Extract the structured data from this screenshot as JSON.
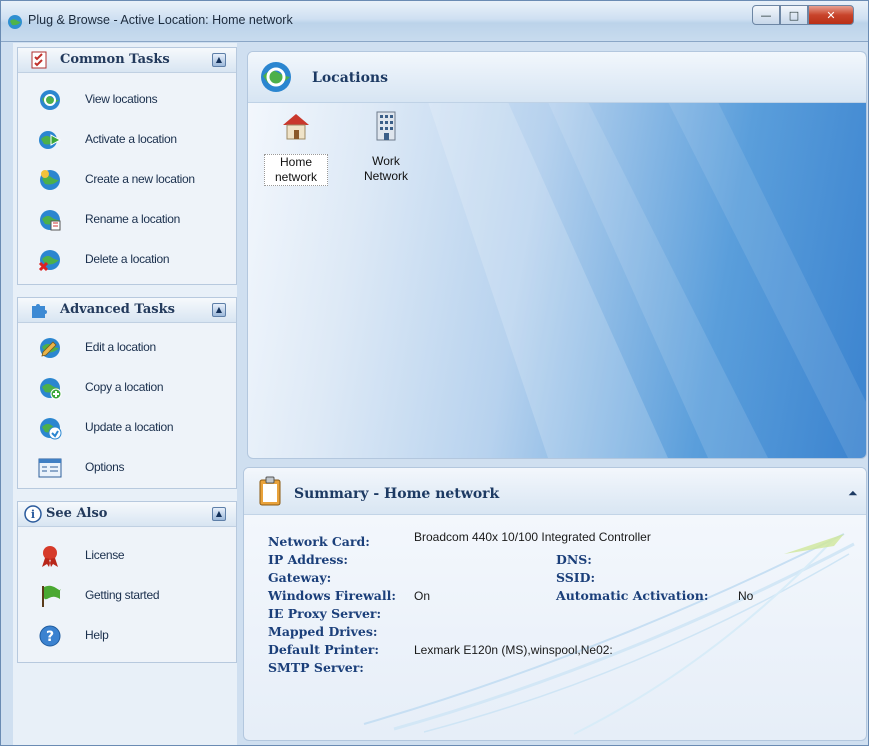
{
  "window": {
    "title": "Plug & Browse - Active Location: Home network",
    "controls": [
      "—",
      "□",
      "✕"
    ]
  },
  "sidebar": {
    "common_tasks": {
      "title": "Common Tasks",
      "items": [
        {
          "label": "View locations",
          "icon": "globe-magnifier-icon"
        },
        {
          "label": "Activate a location",
          "icon": "globe-arrow-icon"
        },
        {
          "label": "Create a new location",
          "icon": "globe-new-icon"
        },
        {
          "label": "Rename a location",
          "icon": "globe-rename-icon"
        },
        {
          "label": "Delete a location",
          "icon": "globe-delete-icon"
        }
      ]
    },
    "advanced_tasks": {
      "title": "Advanced Tasks",
      "items": [
        {
          "label": "Edit a location",
          "icon": "globe-edit-icon"
        },
        {
          "label": "Copy a location",
          "icon": "globe-copy-icon"
        },
        {
          "label": "Update a location",
          "icon": "globe-update-icon"
        },
        {
          "label": "Options",
          "icon": "options-icon"
        }
      ]
    },
    "see_also": {
      "title": "See Also",
      "items": [
        {
          "label": "License",
          "icon": "ribbon-icon"
        },
        {
          "label": "Getting started",
          "icon": "flag-icon"
        },
        {
          "label": "Help",
          "icon": "help-icon"
        }
      ]
    }
  },
  "locations": {
    "title": "Locations",
    "items": [
      {
        "label_line1": "Home",
        "label_line2": "network",
        "icon": "house-icon",
        "selected": true
      },
      {
        "label_line1": "Work",
        "label_line2": "Network",
        "icon": "office-building-icon",
        "selected": false
      }
    ]
  },
  "summary": {
    "title": "Summary - Home network",
    "fields": {
      "network_card": {
        "label": "Network Card:",
        "value": "Broadcom 440x 10/100 Integrated Controller"
      },
      "ip_address": {
        "label": "IP Address:",
        "value": ""
      },
      "gateway": {
        "label": "Gateway:",
        "value": ""
      },
      "windows_firewall": {
        "label": "Windows Firewall:",
        "value": "On"
      },
      "ie_proxy": {
        "label": "IE Proxy Server:",
        "value": ""
      },
      "mapped_drives": {
        "label": "Mapped Drives:",
        "value": ""
      },
      "default_printer": {
        "label": "Default Printer:",
        "value": "Lexmark E120n (MS),winspool,Ne02:"
      },
      "smtp_server": {
        "label": "SMTP Server:",
        "value": ""
      },
      "dns": {
        "label": "DNS:",
        "value": ""
      },
      "ssid": {
        "label": "SSID:",
        "value": ""
      },
      "auto_activation": {
        "label": "Automatic Activation:",
        "value": "No"
      }
    }
  }
}
